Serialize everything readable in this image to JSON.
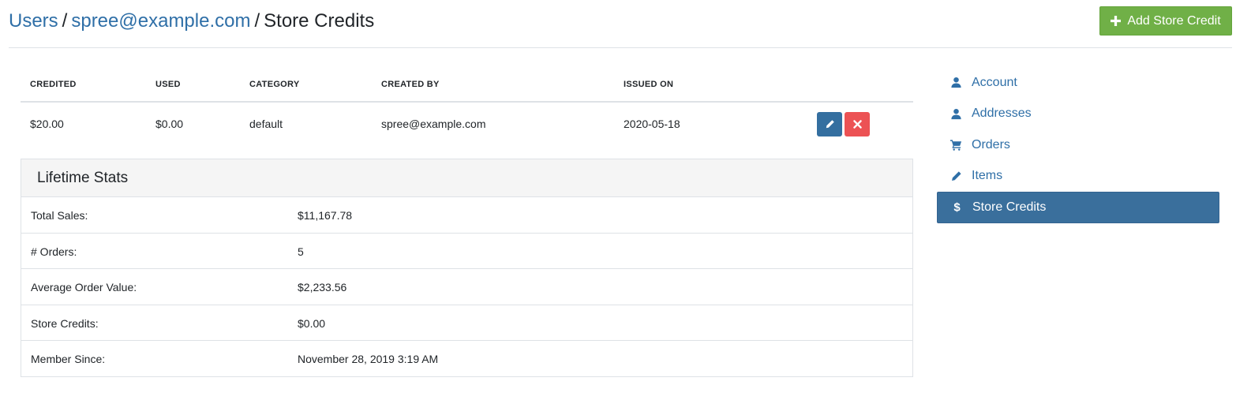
{
  "breadcrumb": {
    "users": "Users",
    "sep1": "/",
    "email": "spree@example.com",
    "sep2": "/",
    "current": "Store Credits"
  },
  "add_button": {
    "label": "Add Store Credit",
    "icon": "plus-icon",
    "color": "#70b047"
  },
  "credits_table": {
    "headers": [
      "CREDITED",
      "USED",
      "CATEGORY",
      "CREATED BY",
      "ISSUED ON"
    ],
    "rows": [
      {
        "credited": "$20.00",
        "used": "$0.00",
        "category": "default",
        "created_by": "spree@example.com",
        "issued_on": "2020-05-18"
      }
    ],
    "row_actions": {
      "edit_icon": "pencil-icon",
      "delete_icon": "close-icon",
      "edit_color": "#346fa0",
      "delete_color": "#ec5254"
    }
  },
  "lifetime_stats": {
    "title": "Lifetime Stats",
    "rows": [
      {
        "label": "Total Sales:",
        "value": "$11,167.78"
      },
      {
        "label": "# Orders:",
        "value": "5"
      },
      {
        "label": "Average Order Value:",
        "value": "$2,233.56"
      },
      {
        "label": "Store Credits:",
        "value": "$0.00"
      },
      {
        "label": "Member Since:",
        "value": "November 28, 2019 3:19 AM"
      }
    ]
  },
  "sidebar": {
    "items": [
      {
        "label": "Account",
        "icon": "user-icon",
        "active": false
      },
      {
        "label": "Addresses",
        "icon": "user-icon",
        "active": false
      },
      {
        "label": "Orders",
        "icon": "cart-icon",
        "active": false
      },
      {
        "label": "Items",
        "icon": "pencil-icon",
        "active": false
      },
      {
        "label": "Store Credits",
        "icon": "dollar-icon",
        "active": true
      }
    ],
    "active_color": "#3a6f9c"
  }
}
